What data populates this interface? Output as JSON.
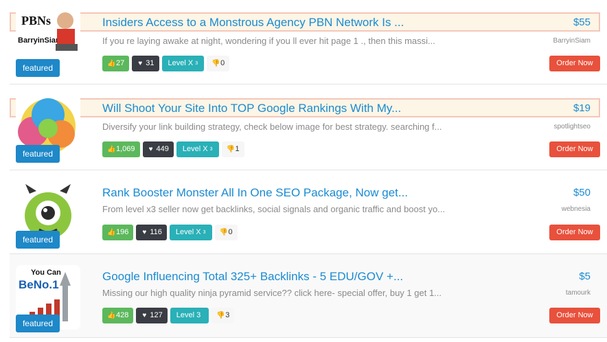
{
  "items": [
    {
      "title": "Insiders Access to a Monstrous Agency PBN Network Is ...",
      "price": "$55",
      "description": "If you re laying awake at night, wondering if you ll ever hit page 1 ., then this massi...",
      "seller": "BarryinSiam",
      "likes": "27",
      "hearts": "31",
      "level": "Level X",
      "level_sup": "3",
      "dislikes": "0",
      "featured": "featured",
      "order": "Order Now",
      "thumb_text_1": "PBNs",
      "thumb_text_2": "BarryinSiam"
    },
    {
      "title": "Will Shoot Your Site Into TOP Google Rankings With My...",
      "price": "$19",
      "description": "Diversify your link building strategy, check below image for best strategy. searching f...",
      "seller": "spotlightseo",
      "likes": "1,069",
      "hearts": "449",
      "level": "Level X",
      "level_sup": "3",
      "dislikes": "1",
      "featured": "featured",
      "order": "Order Now"
    },
    {
      "title": "Rank Booster Monster All In One SEO Package, Now get...",
      "price": "$50",
      "description": "From level x3 seller now get backlinks, social signals and organic traffic and boost yo...",
      "seller": "webnesia",
      "likes": "196",
      "hearts": "116",
      "level": "Level X",
      "level_sup": "3",
      "dislikes": "0",
      "featured": "featured",
      "order": "Order Now"
    },
    {
      "title": "Google Influencing Total 325+ Backlinks - 5 EDU/GOV +...",
      "price": "$5",
      "description": "Missing our high quality ninja pyramid service?? click here- special offer, buy 1 get 1...",
      "seller": "tamourk",
      "likes": "428",
      "hearts": "127",
      "level": "Level 3",
      "level_sup": "",
      "dislikes": "3",
      "featured": "featured",
      "order": "Order Now",
      "thumb_text_1": "You Can",
      "thumb_text_2": "BeNo.1"
    }
  ],
  "colors": {
    "accent": "#1a8bd1",
    "featured": "#1e88c8",
    "like": "#5cb85c",
    "heart": "#3a3d44",
    "level": "#2ab0b7",
    "order": "#e8513c"
  },
  "icons": {
    "like": "thumbs-up-icon",
    "heart": "heart-icon",
    "dislike": "thumbs-down-icon"
  }
}
